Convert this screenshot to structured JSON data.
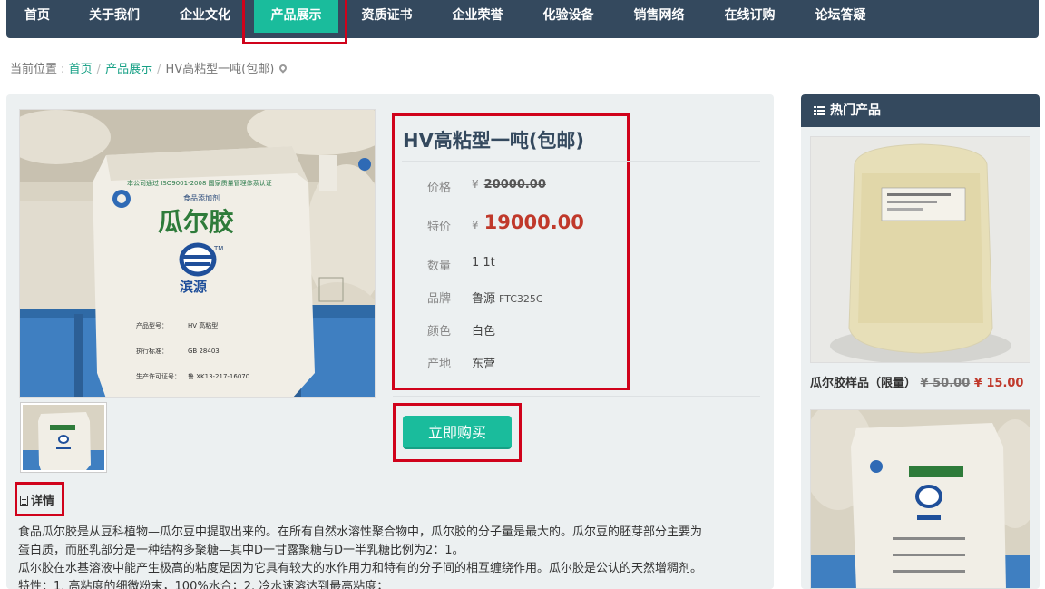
{
  "nav": {
    "items": [
      {
        "label": "首页"
      },
      {
        "label": "关于我们"
      },
      {
        "label": "企业文化"
      },
      {
        "label": "产品展示"
      },
      {
        "label": "资质证书"
      },
      {
        "label": "企业荣誉"
      },
      {
        "label": "化验设备"
      },
      {
        "label": "销售网络"
      },
      {
        "label": "在线订购"
      },
      {
        "label": "论坛答疑"
      }
    ],
    "active_color": "#1abc9c",
    "bar_color": "#34495e"
  },
  "breadcrumb": {
    "prefix": "当前位置 :",
    "home": "首页",
    "category": "产品展示",
    "current": "HV高粘型一吨(包邮)"
  },
  "product": {
    "title": "HV高粘型一吨(包邮)",
    "price_label": "价格",
    "currency": "¥",
    "price": "20000.00",
    "special_label": "特价",
    "special_price": "19000.00",
    "qty_label": "数量",
    "qty": "1 1t",
    "brand_label": "品牌",
    "brand": "鲁源",
    "model": "FTC325C",
    "color_label": "颜色",
    "color": "白色",
    "origin_label": "产地",
    "origin": "东营",
    "buy_label": "立即购买",
    "image_text": {
      "name": "瓜尔胶",
      "logo": "滨源",
      "category": "食品添加剂",
      "tm": "TM",
      "spec_model_label": "产品型号：",
      "spec_model": "HV 高粘型",
      "spec_std_label": "执行标准：",
      "spec_std": "GB 28403",
      "spec_license_label": "生产许可证号：",
      "spec_license": "鲁 XK13-217-16070"
    }
  },
  "detail": {
    "tab_label": "详情",
    "lines": [
      "食品瓜尔胶是从豆科植物—瓜尔豆中提取出来的。在所有自然水溶性聚合物中，瓜尔胶的分子量是最大的。瓜尔豆的胚芽部分主要为",
      "蛋白质，而胚乳部分是一种结构多聚糖—其中D一甘露聚糖与D一半乳糖比例为2：1。",
      "瓜尔胶在水基溶液中能产生极高的粘度是因为它具有较大的水作用力和特有的分子间的相互缠绕作用。瓜尔胶是公认的天然增稠剂。",
      "特性：1. 高粘度的细微粉末，100%水合；2. 冷水速溶达到最高粘度；"
    ]
  },
  "sidebar": {
    "title": "热门产品",
    "items": [
      {
        "name": "瓜尔胶样品（限量）",
        "currency": "¥",
        "old_price": "50.00",
        "new_price": "15.00"
      }
    ]
  }
}
